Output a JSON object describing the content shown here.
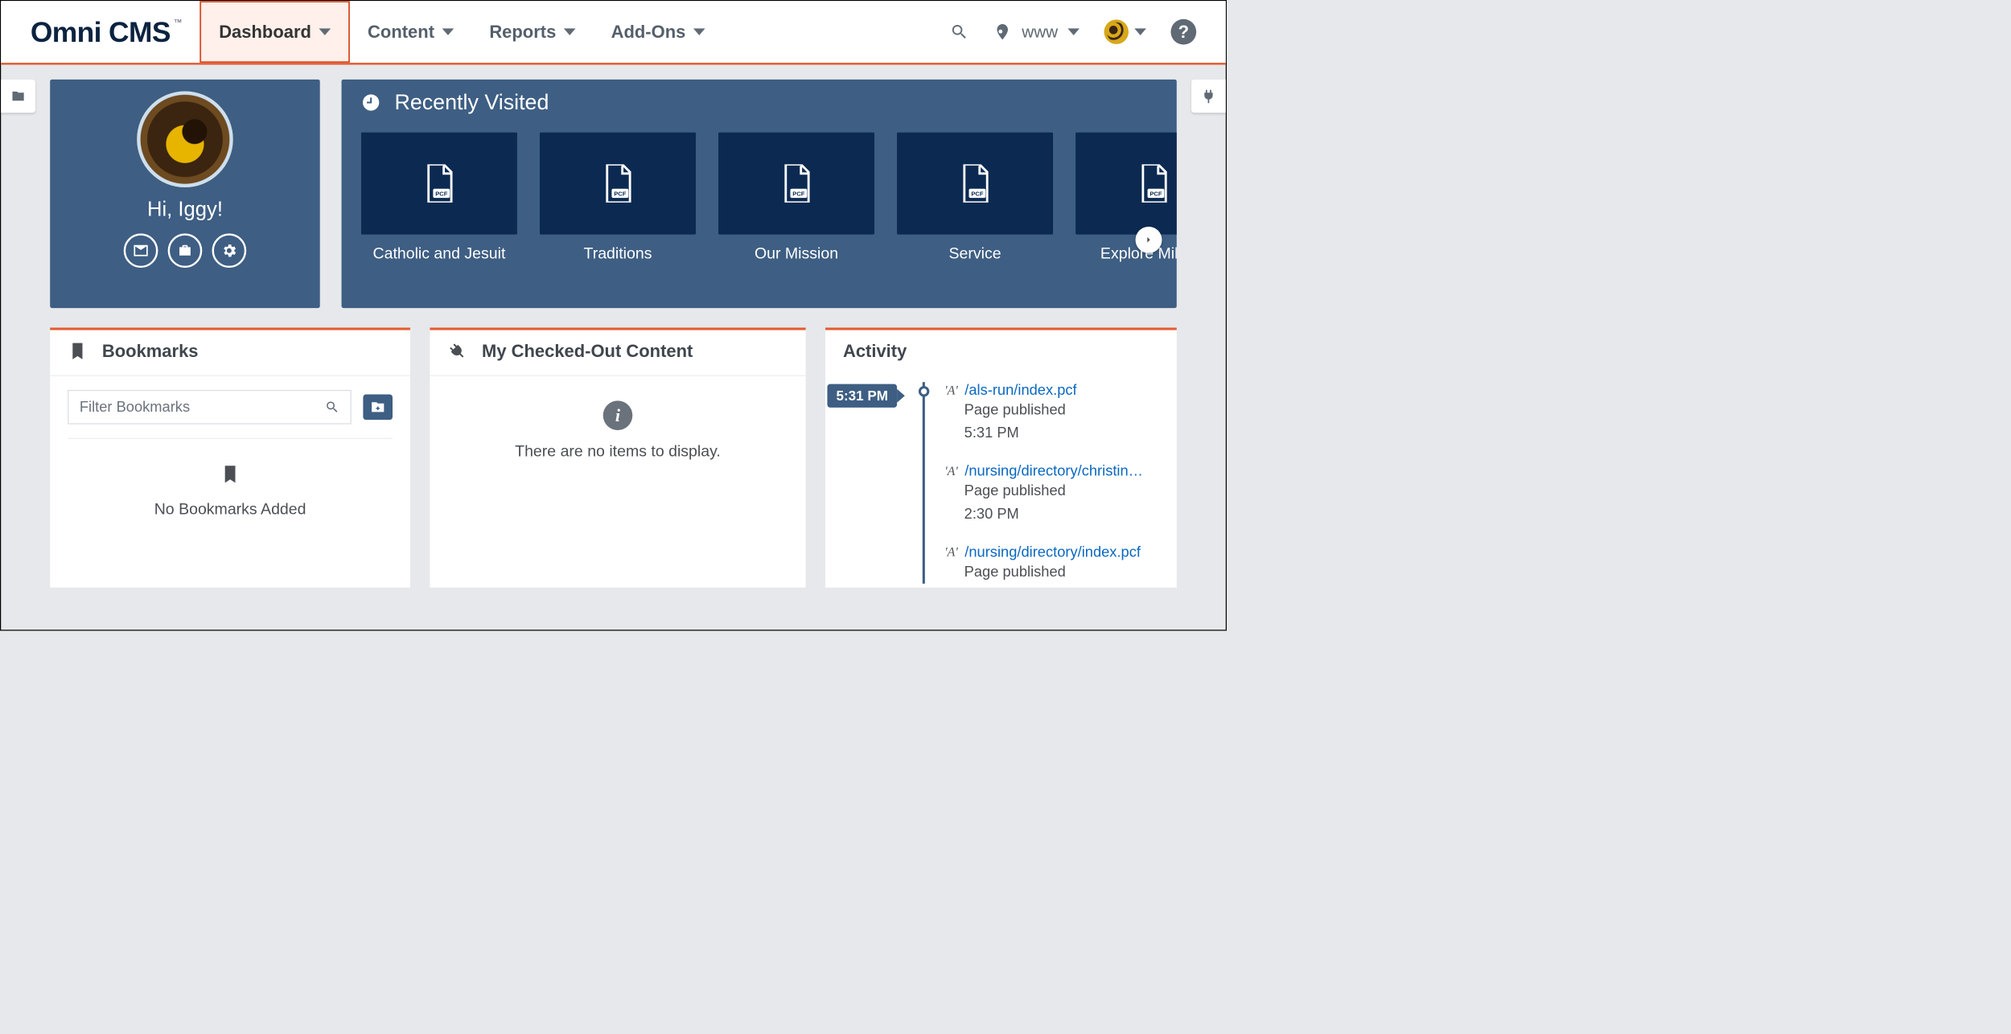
{
  "brand": {
    "name": "Omni CMS",
    "tm": "™"
  },
  "nav": {
    "items": [
      {
        "label": "Dashboard",
        "active": true
      },
      {
        "label": "Content"
      },
      {
        "label": "Reports"
      },
      {
        "label": "Add-Ons"
      }
    ],
    "site": "www"
  },
  "profile": {
    "greeting": "Hi, Iggy!"
  },
  "recent": {
    "title": "Recently Visited",
    "tiles": [
      {
        "label": "Catholic and Jesuit",
        "type": "PCF"
      },
      {
        "label": "Traditions",
        "type": "PCF"
      },
      {
        "label": "Our Mission",
        "type": "PCF"
      },
      {
        "label": "Service",
        "type": "PCF"
      },
      {
        "label": "Explore Milwau",
        "type": "PCF"
      }
    ]
  },
  "bookmarks": {
    "title": "Bookmarks",
    "filter_placeholder": "Filter Bookmarks",
    "empty": "No Bookmarks Added"
  },
  "checked": {
    "title": "My Checked-Out Content",
    "empty": "There are no items to display."
  },
  "activity": {
    "title": "Activity",
    "badge_time": "5:31 PM",
    "items": [
      {
        "path": "/als-run/index.pcf",
        "action": "Page published",
        "time": "5:31 PM"
      },
      {
        "path": "/nursing/directory/christine-sh…",
        "action": "Page published",
        "time": "2:30 PM"
      },
      {
        "path": "/nursing/directory/index.pcf",
        "action": "Page published",
        "time": ""
      }
    ]
  }
}
